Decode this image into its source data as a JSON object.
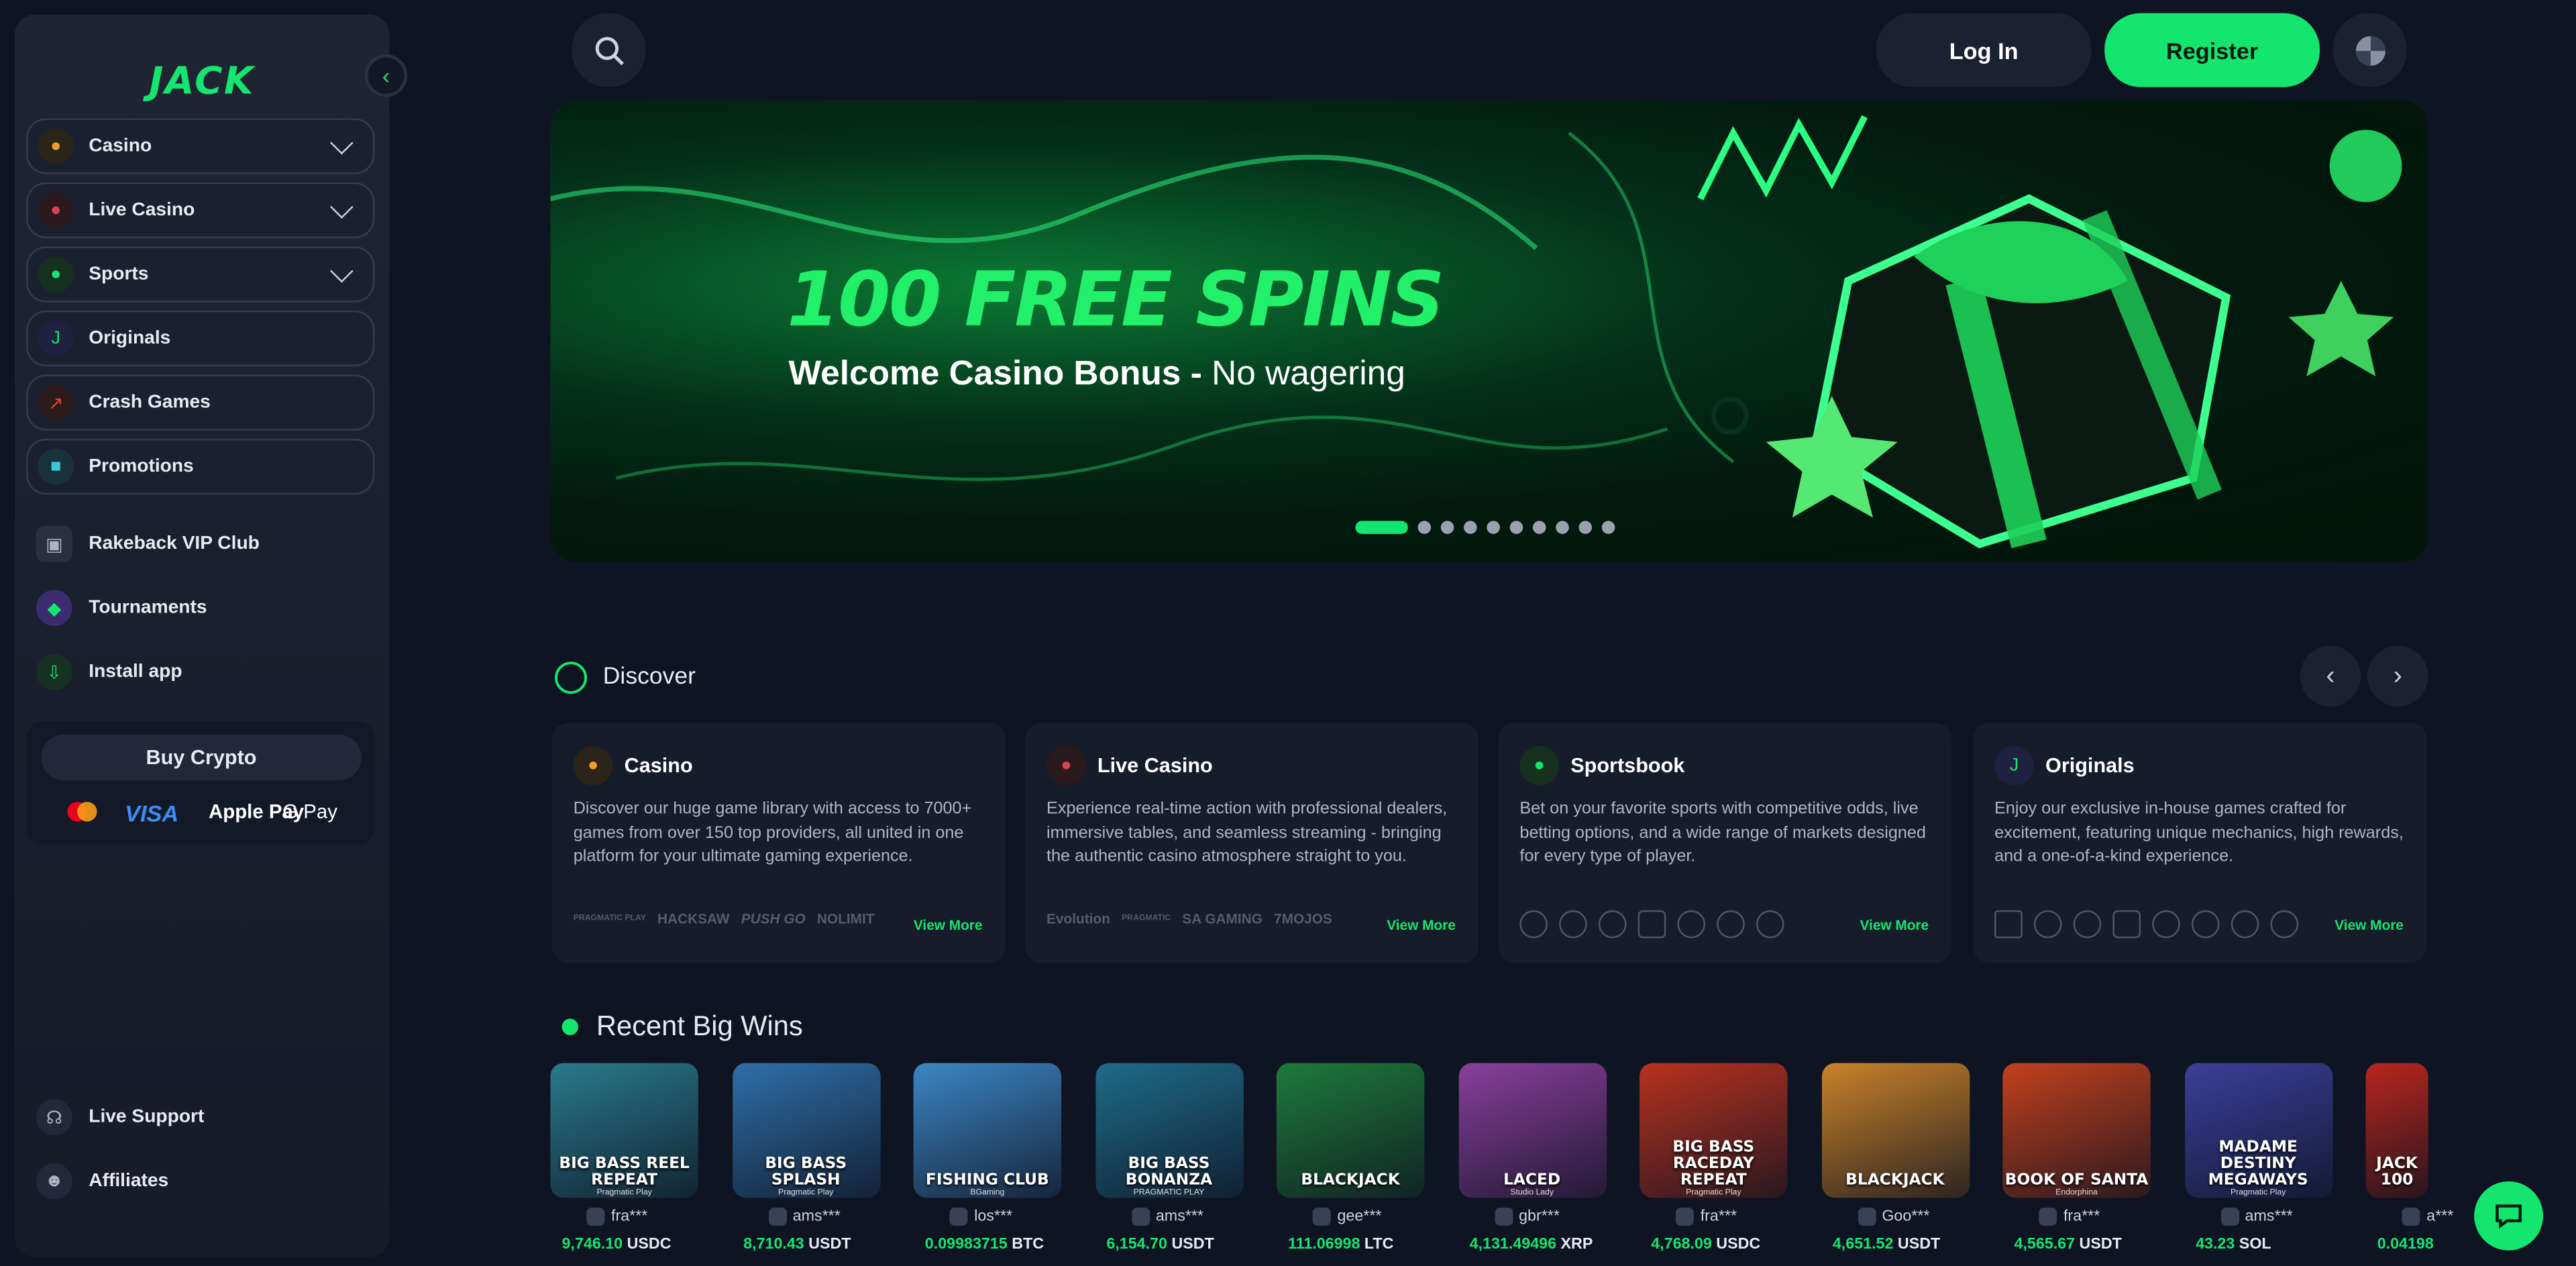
{
  "brand": {
    "logo_text": "JACK",
    "accent": "#14e56f"
  },
  "sidebar": {
    "items": [
      {
        "label": "Casino",
        "icon": "casino-icon",
        "dropdown": true
      },
      {
        "label": "Live Casino",
        "icon": "live-casino-icon",
        "dropdown": true
      },
      {
        "label": "Sports",
        "icon": "sports-icon",
        "dropdown": true
      },
      {
        "label": "Originals",
        "icon": "originals-icon",
        "dropdown": false
      },
      {
        "label": "Crash Games",
        "icon": "crash-icon",
        "dropdown": false
      },
      {
        "label": "Promotions",
        "icon": "promotions-icon",
        "dropdown": false
      }
    ],
    "extras": [
      {
        "label": "Rakeback VIP Club",
        "icon": "gift-icon"
      },
      {
        "label": "Tournaments",
        "icon": "trophy-icon"
      },
      {
        "label": "Install app",
        "icon": "install-icon"
      }
    ],
    "buy_crypto": {
      "label": "Buy Crypto",
      "methods": [
        "Mastercard",
        "VISA",
        "Apple Pay",
        "G Pay"
      ]
    },
    "bottom": [
      {
        "label": "Live Support",
        "icon": "headset-icon"
      },
      {
        "label": "Affiliates",
        "icon": "users-icon"
      }
    ]
  },
  "header": {
    "login_label": "Log In",
    "register_label": "Register"
  },
  "banner": {
    "title": "100 FREE SPINS",
    "subtitle_bold": "Welcome Casino Bonus -",
    "subtitle_rest": " No wagering",
    "slides": 10,
    "active_slide": 1
  },
  "discover": {
    "title": "Discover",
    "cards": [
      {
        "title": "Casino",
        "icon": "casino-icon",
        "description": "Discover our huge game library with access to 7000+ games from over 150 top providers, all united in one platform for your ultimate gaming experience.",
        "more": "View More",
        "logos": [
          "PRAGMATIC PLAY",
          "HACKSAW",
          "PUSH GO",
          "NOLIMIT"
        ]
      },
      {
        "title": "Live Casino",
        "icon": "live-casino-icon",
        "description": "Experience real-time action with professional dealers, immersive tables, and seamless streaming - bringing the authentic casino atmosphere straight to you.",
        "more": "View More",
        "logos": [
          "Evolution",
          "PRAGMATIC",
          "SA GAMING",
          "7MOJOS"
        ]
      },
      {
        "title": "Sportsbook",
        "icon": "sports-icon",
        "description": "Bet on your favorite sports with competitive odds, live betting options, and a wide range of markets designed for every type of player.",
        "more": "View More",
        "logos": []
      },
      {
        "title": "Originals",
        "icon": "originals-icon",
        "description": "Enjoy our exclusive in-house games crafted for excitement, featuring unique mechanics, high rewards, and a one-of-a-kind experience.",
        "more": "View More",
        "logos": []
      }
    ]
  },
  "big_wins": {
    "title": "Recent Big Wins",
    "items": [
      {
        "game": "BIG BASS REEL REPEAT",
        "provider": "Pragmatic Play",
        "user": "fra***",
        "amount": "9,746.10",
        "currency": "USDC",
        "color": "#2a7a8c"
      },
      {
        "game": "BIG BASS SPLASH",
        "provider": "Pragmatic Play",
        "user": "ams***",
        "amount": "8,710.43",
        "currency": "USDT",
        "color": "#2f6fa8"
      },
      {
        "game": "FISHING CLUB",
        "provider": "BGaming",
        "user": "los***",
        "amount": "0.09983715",
        "currency": "BTC",
        "color": "#3d86c4"
      },
      {
        "game": "BIG BASS BONANZA",
        "provider": "PRAGMATIC PLAY",
        "user": "ams***",
        "amount": "6,154.70",
        "currency": "USDT",
        "color": "#1f6b8a"
      },
      {
        "game": "BLACKJACK",
        "provider": "",
        "user": "gee***",
        "amount": "111.06998",
        "currency": "LTC",
        "color": "#1f7a3a"
      },
      {
        "game": "LACED",
        "provider": "Studio Lady",
        "user": "gbr***",
        "amount": "4,131.49496",
        "currency": "XRP",
        "color": "#8a3f9c"
      },
      {
        "game": "BIG BASS RACEDAY REPEAT",
        "provider": "Pragmatic Play",
        "user": "fra***",
        "amount": "4,768.09",
        "currency": "USDC",
        "color": "#b8321f"
      },
      {
        "game": "BLACKJACK",
        "provider": "",
        "user": "Goo***",
        "amount": "4,651.52",
        "currency": "USDT",
        "color": "#c9822a"
      },
      {
        "game": "BOOK OF SANTA",
        "provider": "Endorphina",
        "user": "fra***",
        "amount": "4,565.67",
        "currency": "USDT",
        "color": "#c2401d"
      },
      {
        "game": "MADAME DESTINY MEGAWAYS",
        "provider": "Pragmatic Play",
        "user": "ams***",
        "amount": "43.23",
        "currency": "SOL",
        "color": "#3b3f9a"
      },
      {
        "game": "JACK 100",
        "provider": "",
        "user": "a***",
        "amount": "0.04198",
        "currency": "",
        "color": "#b8261d"
      }
    ]
  }
}
